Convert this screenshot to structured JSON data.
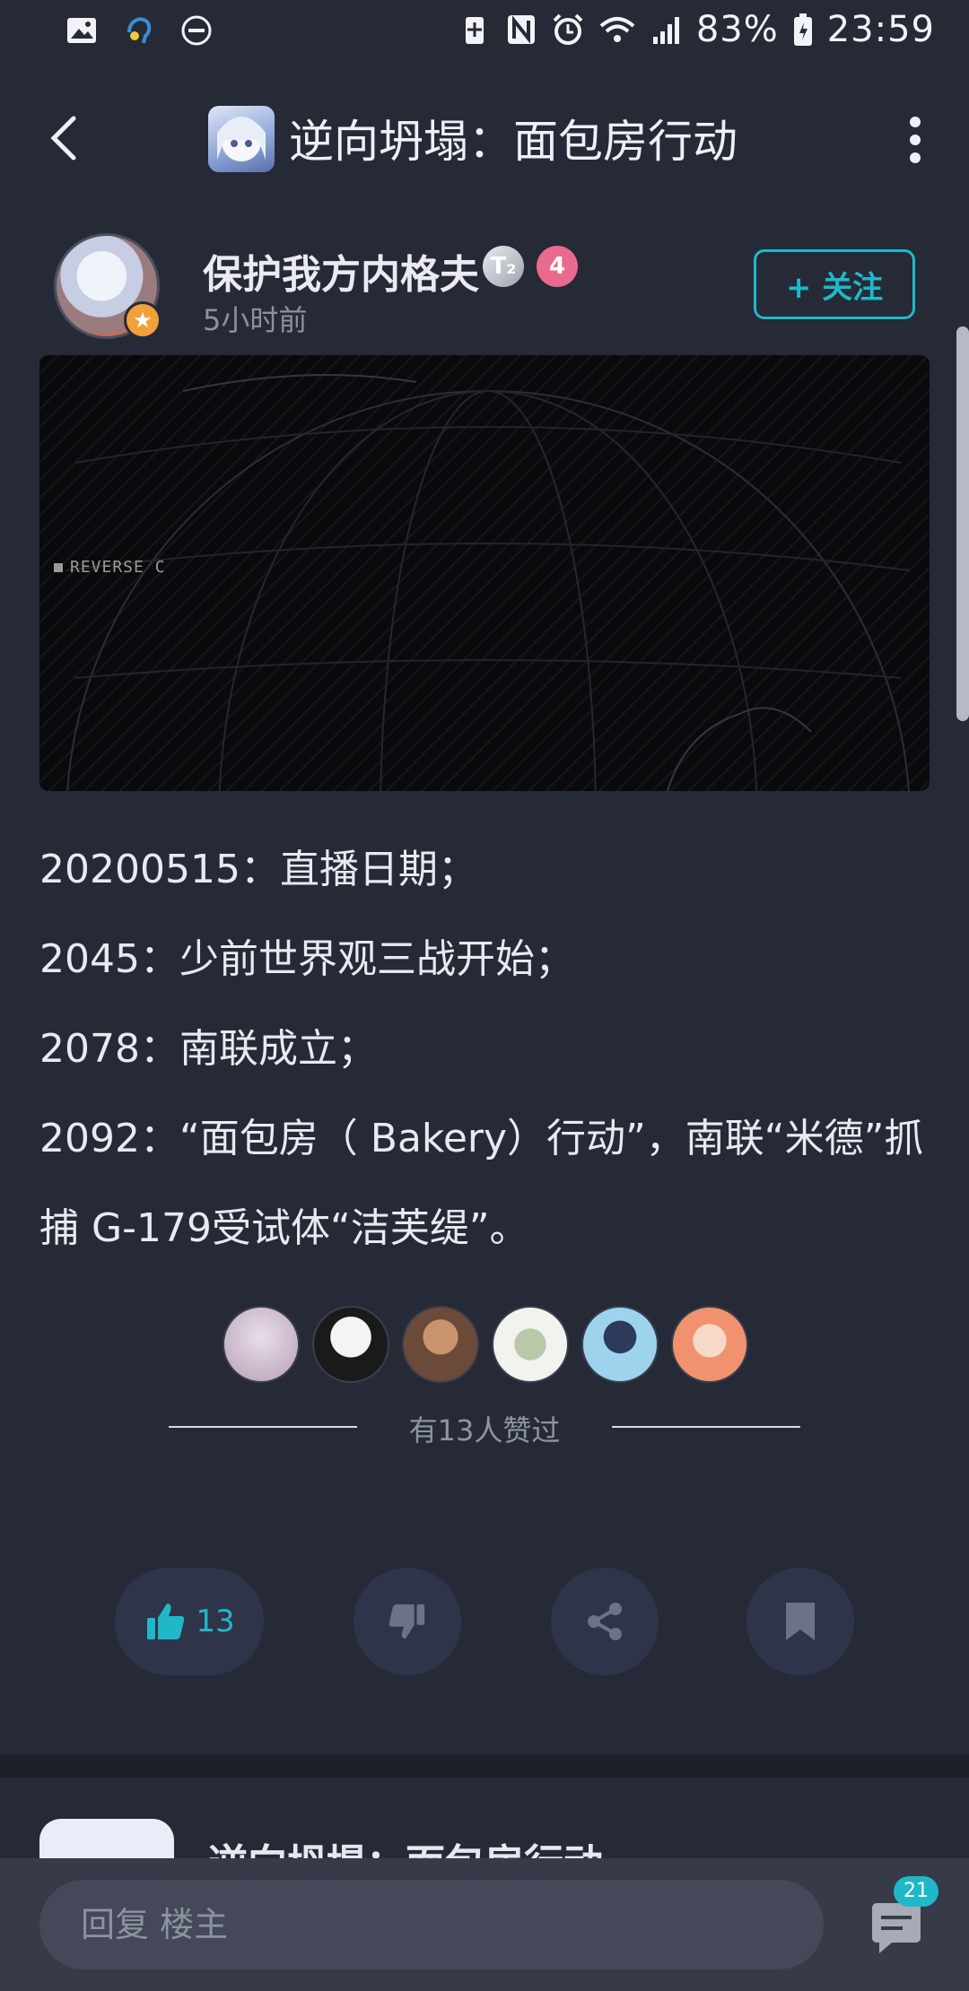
{
  "status_bar": {
    "battery": "83%",
    "time": "23:59",
    "icons": [
      "image-icon",
      "assistant-icon",
      "do-not-disturb-icon",
      "battery-saver-icon",
      "nfc-icon",
      "alarm-icon",
      "wifi-icon",
      "signal-icon",
      "battery-icon"
    ]
  },
  "header": {
    "title": "逆向坍塌：面包房行动"
  },
  "post": {
    "author": "保护我方内格夫",
    "badges": [
      "T₂",
      "4"
    ],
    "time": "5小时前",
    "follow_label": "+ 关注",
    "media_overlay_text": "REVERSE C",
    "lines": [
      "20200515：直播日期；",
      "2045：少前世界观三战开始；",
      "2078：南联成立；",
      "2092：“面包房（ Bakery）行动”，南联“米德”抓",
      "捕 G-179受试体“洁芙缇”。"
    ]
  },
  "likers": {
    "summary": "有13人赞过",
    "colors": [
      "#c9b8c6",
      "#1a1a1a",
      "#6b4a3a",
      "#e5e8df",
      "#9ed3ee",
      "#f1b49b"
    ]
  },
  "actions": {
    "like_count": "13",
    "accent": "#1fb8c9"
  },
  "next_preview": {
    "title": "逆向坍塌：面包房行动"
  },
  "reply": {
    "placeholder": "回复  楼主",
    "comment_count": "21"
  }
}
